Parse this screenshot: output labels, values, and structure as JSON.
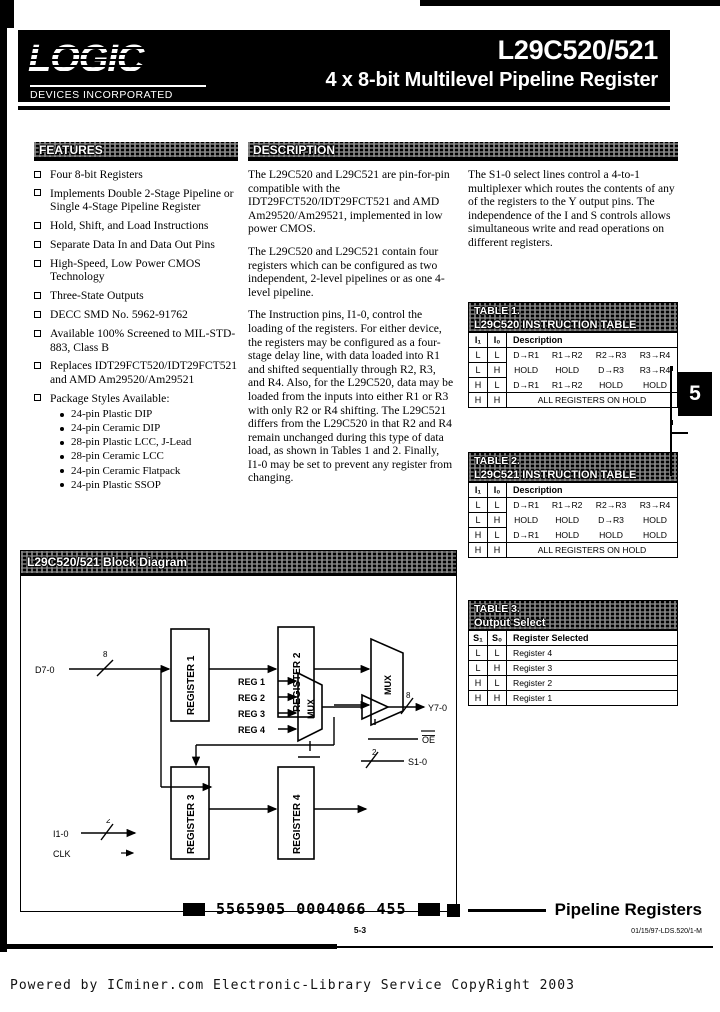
{
  "header": {
    "logo_word": "LOGIC",
    "logo_sub": "DEVICES INCORPORATED",
    "part_number": "L29C520/521",
    "subtitle": "4 x 8-bit Multilevel Pipeline Register"
  },
  "banners": {
    "features": "FEATURES",
    "description": "DESCRIPTION",
    "block_diagram": "L29C520/521 Block Diagram"
  },
  "features": [
    {
      "text": "Four 8-bit Registers"
    },
    {
      "text": "Implements Double 2-Stage Pipeline or Single 4-Stage Pipeline Register"
    },
    {
      "text": "Hold, Shift, and Load Instructions"
    },
    {
      "text": "Separate Data In and Data Out Pins"
    },
    {
      "text": "High-Speed, Low Power CMOS Technology"
    },
    {
      "text": "Three-State Outputs"
    },
    {
      "text": "DECC SMD No. 5962-91762"
    },
    {
      "text": "Available 100% Screened to MIL-STD-883, Class B"
    },
    {
      "text": "Replaces IDT29FCT520/IDT29FCT521 and AMD Am29520/Am29521"
    },
    {
      "text": "Package Styles Available:",
      "sub": [
        "24-pin Plastic DIP",
        "24-pin Ceramic DIP",
        "28-pin Plastic LCC, J-Lead",
        "28-pin Ceramic LCC",
        "24-pin Ceramic Flatpack",
        "24-pin Plastic SSOP"
      ]
    }
  ],
  "description_paragraphs": [
    "The L29C520 and L29C521 are pin-for-pin compatible with the IDT29FCT520/IDT29FCT521 and AMD Am29520/Am29521, implemented in low power CMOS.",
    "The L29C520 and L29C521 contain four registers which can be configured as two independent, 2-level pipelines or as one 4-level pipeline.",
    "The Instruction pins, I1-0, control the loading of the registers.  For either device, the registers may be configured as a four-stage delay line, with data loaded into R1 and shifted sequentially through R2, R3, and R4.  Also, for the L29C520, data may be loaded from the inputs into either R1 or R3 with only R2 or R4 shifting.  The L29C521 differs from the L29C520 in that R2 and R4 remain unchanged during this type of data load, as shown in Tables 1 and 2.  Finally, I1-0 may be set to prevent any register from changing."
  ],
  "right_column_paragraphs": [
    "The S1-0 select lines control a 4-to-1 multiplexer which routes the contents of any of the registers to the Y output pins.  The independence of the I and S controls allows simultaneous write and read operations on different registers."
  ],
  "tables": [
    {
      "label": "TABLE 1.",
      "title": "L29C520 INSTRUCTION TABLE",
      "headers": [
        "I₁",
        "I₀",
        "Description"
      ],
      "rows": [
        {
          "i1": "L",
          "i0": "L",
          "cells": [
            "D→R1",
            "R1→R2",
            "R2→R3",
            "R3→R4"
          ]
        },
        {
          "i1": "L",
          "i0": "H",
          "cells": [
            "HOLD",
            "HOLD",
            "D→R3",
            "R3→R4"
          ]
        },
        {
          "i1": "H",
          "i0": "L",
          "cells": [
            "D→R1",
            "R1→R2",
            "HOLD",
            "HOLD"
          ]
        },
        {
          "i1": "H",
          "i0": "H",
          "span": "ALL REGISTERS ON HOLD"
        }
      ]
    },
    {
      "label": "TABLE 2.",
      "title": "L29C521 INSTRUCTION TABLE",
      "headers": [
        "I₁",
        "I₀",
        "Description"
      ],
      "rows": [
        {
          "i1": "L",
          "i0": "L",
          "cells": [
            "D→R1",
            "R1→R2",
            "R2→R3",
            "R3→R4"
          ]
        },
        {
          "i1": "L",
          "i0": "H",
          "cells": [
            "HOLD",
            "HOLD",
            "D→R3",
            "HOLD"
          ]
        },
        {
          "i1": "H",
          "i0": "L",
          "cells": [
            "D→R1",
            "HOLD",
            "HOLD",
            "HOLD"
          ]
        },
        {
          "i1": "H",
          "i0": "H",
          "span": "ALL REGISTERS ON HOLD"
        }
      ]
    },
    {
      "label": "TABLE 3.",
      "title": "Output Select",
      "headers": [
        "S₁",
        "S₀",
        "Register Selected"
      ],
      "rows": [
        {
          "i1": "L",
          "i0": "L",
          "span": "Register 4"
        },
        {
          "i1": "L",
          "i0": "H",
          "span": "Register 3"
        },
        {
          "i1": "H",
          "i0": "L",
          "span": "Register 2"
        },
        {
          "i1": "H",
          "i0": "H",
          "span": "Register 1"
        }
      ]
    }
  ],
  "block_diagram": {
    "input_bus_label": "D7-0",
    "input_bus_width": "8",
    "registers": [
      "REGISTER 1",
      "REGISTER 2",
      "REGISTER 3",
      "REGISTER 4"
    ],
    "mux_label": "MUX",
    "mux_inputs": [
      "REG 1",
      "REG 2",
      "REG 3",
      "REG 4"
    ],
    "output_label": "Y7-0",
    "output_bus_width": "8",
    "oe_label": "OE",
    "select_label": "S1-0",
    "select_width": "2",
    "instruction_label": "I1-0",
    "instruction_width": "2",
    "clock_label": "CLK"
  },
  "side_tab": {
    "number": "5"
  },
  "footer": {
    "barcode_digits": "5565905 0004066 455",
    "family_title": "Pipeline Registers",
    "doc_id": "01/15/97-LDS.520/1-M",
    "page_number": "5-3",
    "scan_credit": "Powered by ICminer.com Electronic-Library Service CopyRight 2003"
  }
}
